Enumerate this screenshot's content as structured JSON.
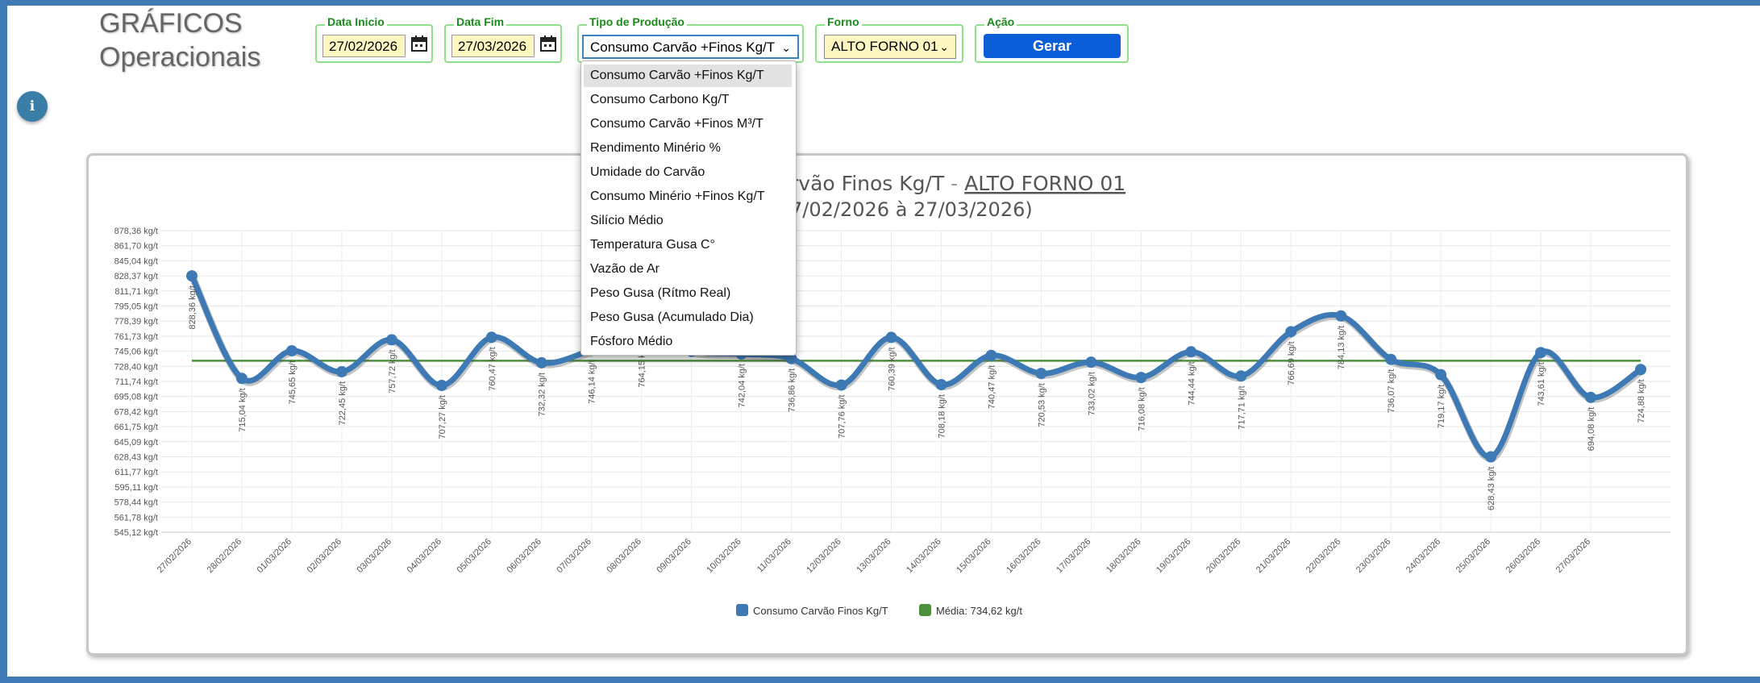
{
  "page": {
    "title_line1": "GRÁFICOS",
    "title_line2": "Operacionais",
    "info_label": "i"
  },
  "filters": {
    "data_inicio": {
      "legend": "Data Inicio",
      "value": "27/02/2026"
    },
    "data_fim": {
      "legend": "Data Fim",
      "value": "27/03/2026"
    },
    "tipo": {
      "legend": "Tipo de Produção",
      "value": "Consumo Carvão +Finos Kg/T"
    },
    "forno": {
      "legend": "Forno",
      "value": "ALTO FORNO 01"
    },
    "acao": {
      "legend": "Ação",
      "button": "Gerar"
    }
  },
  "dropdown": {
    "options": [
      "Consumo Carvão +Finos Kg/T",
      "Consumo Carbono Kg/T",
      "Consumo Carvão +Finos M³/T",
      "Rendimento Minério %",
      "Umidade do Carvão",
      "Consumo Minério +Finos Kg/T",
      "Silício Médio",
      "Temperatura Gusa C°",
      "Vazão de Ar",
      "Peso Gusa (Rítmo Real)",
      "Peso Gusa (Acumulado Dia)",
      "Fósforo Médio"
    ],
    "selected_index": 0
  },
  "chart_data": {
    "type": "line",
    "title_visible_part": "rvão  Finos Kg/T",
    "title_separator": " - ",
    "title_furnace": "ALTO FORNO 01",
    "subtitle_visible_part": "7/02/2026 à 27/03/2026)",
    "categories": [
      "27/02/2026",
      "28/02/2026",
      "01/03/2026",
      "02/03/2026",
      "03/03/2026",
      "04/03/2026",
      "05/03/2026",
      "06/03/2026",
      "07/03/2026",
      "08/03/2026",
      "09/03/2026",
      "10/03/2026",
      "11/03/2026",
      "12/03/2026",
      "13/03/2026",
      "14/03/2026",
      "15/03/2026",
      "16/03/2026",
      "17/03/2026",
      "18/03/2026",
      "19/03/2026",
      "20/03/2026",
      "21/03/2026",
      "22/03/2026",
      "23/03/2026",
      "24/03/2026",
      "25/03/2026",
      "26/03/2026",
      "27/03/2026"
    ],
    "series": [
      {
        "name": "Consumo Carvão  Finos Kg/T",
        "color": "#3d7ab5",
        "values": [
          828.36,
          715.04,
          745.65,
          722.45,
          757.72,
          707.27,
          760.47,
          732.32,
          746.14,
          764.15,
          745.0,
          742.04,
          736.86,
          707.76,
          760.39,
          708.18,
          740.47,
          720.53,
          733.02,
          716.08,
          744.44,
          717.71,
          766.69,
          784.13,
          736.07,
          719.17,
          628.43,
          743.61,
          694.08,
          724.88
        ],
        "point_labels": [
          "828,36 kg/t",
          "715,04 kg/t",
          "745,65 kg/t",
          "722,45 kg/t",
          "757,72 kg/t",
          "707,27 kg/t",
          "760,47 kg/t",
          "732,32 kg/t",
          "746,14 kg/t",
          "764,15 kg/t",
          "",
          "742,04 kg/t",
          "736,86 kg/t",
          "707,76 kg/t",
          "760,39 kg/t",
          "708,18 kg/t",
          "740,47 kg/t",
          "720,53 kg/t",
          "733,02 kg/t",
          "716,08 kg/t",
          "744,44 kg/t",
          "717,71 kg/t",
          "766,69 kg/t",
          "784,13 kg/t",
          "736,07 kg/t",
          "719,17 kg/t",
          "628,43 kg/t",
          "743,61 kg/t",
          "694,08 kg/t",
          "724,88 kg/t"
        ]
      },
      {
        "name": "Média: 734,62 kg/t",
        "color": "#4e8f3d",
        "constant": 734.62
      }
    ],
    "y_ticks": [
      "878,36 kg/t",
      "861,70 kg/t",
      "845,04 kg/t",
      "828,37 kg/t",
      "811,71 kg/t",
      "795,05 kg/t",
      "778,39 kg/t",
      "761,73 kg/t",
      "745,06 kg/t",
      "728,40 kg/t",
      "711,74 kg/t",
      "695,08 kg/t",
      "678,42 kg/t",
      "661,75 kg/t",
      "645,09 kg/t",
      "628,43 kg/t",
      "611,77 kg/t",
      "595,11 kg/t",
      "578,44 kg/t",
      "561,78 kg/t",
      "545,12 kg/t"
    ],
    "ylim": [
      545.12,
      878.36
    ],
    "grid": true,
    "legend_position": "bottom-center"
  }
}
